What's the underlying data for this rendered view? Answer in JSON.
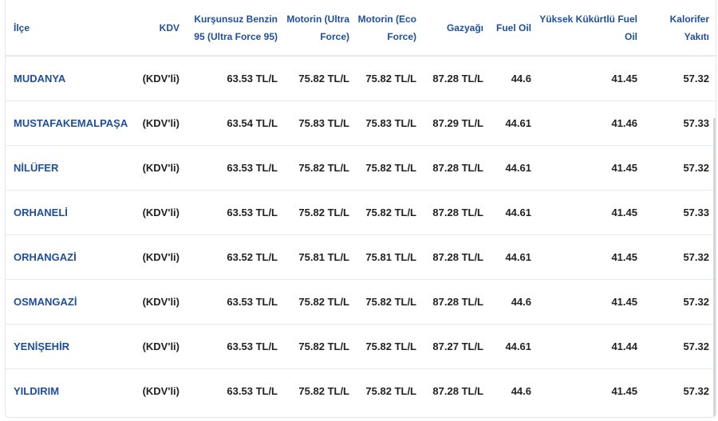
{
  "table": {
    "headers": [
      "İlçe",
      "KDV",
      "Kurşunsuz Benzin 95 (Ultra Force 95)",
      "Motorin (Ultra Force)",
      "Motorin (Eco Force)",
      "Gazyağı",
      "Fuel Oil",
      "Yüksek Kükürtlü Fuel Oil",
      "Kalorifer Yakıtı"
    ],
    "rows": [
      [
        "MUDANYA",
        "(KDV'li)",
        "63.53 TL/L",
        "75.82 TL/L",
        "75.82 TL/L",
        "87.28 TL/L",
        "44.6",
        "41.45",
        "57.32"
      ],
      [
        "MUSTAFAKEMALPAŞA",
        "(KDV'li)",
        "63.54 TL/L",
        "75.83 TL/L",
        "75.83 TL/L",
        "87.29 TL/L",
        "44.61",
        "41.46",
        "57.33"
      ],
      [
        "NİLÜFER",
        "(KDV'li)",
        "63.53 TL/L",
        "75.82 TL/L",
        "75.82 TL/L",
        "87.28 TL/L",
        "44.61",
        "41.45",
        "57.32"
      ],
      [
        "ORHANELİ",
        "(KDV'li)",
        "63.53 TL/L",
        "75.82 TL/L",
        "75.82 TL/L",
        "87.28 TL/L",
        "44.61",
        "41.45",
        "57.33"
      ],
      [
        "ORHANGAZİ",
        "(KDV'li)",
        "63.52 TL/L",
        "75.81 TL/L",
        "75.81 TL/L",
        "87.28 TL/L",
        "44.61",
        "41.45",
        "57.32"
      ],
      [
        "OSMANGAZİ",
        "(KDV'li)",
        "63.53 TL/L",
        "75.82 TL/L",
        "75.82 TL/L",
        "87.28 TL/L",
        "44.6",
        "41.45",
        "57.32"
      ],
      [
        "YENİŞEHİR",
        "(KDV'li)",
        "63.53 TL/L",
        "75.82 TL/L",
        "75.82 TL/L",
        "87.27 TL/L",
        "44.61",
        "41.44",
        "57.32"
      ],
      [
        "YILDIRIM",
        "(KDV'li)",
        "63.53 TL/L",
        "75.82 TL/L",
        "75.82 TL/L",
        "87.28 TL/L",
        "44.6",
        "41.45",
        "57.32"
      ]
    ]
  },
  "colors": {
    "header_text": "#1e4f9c",
    "district_text": "#1e4f9c",
    "cell_text": "#222222",
    "row_border": "#e8eaee"
  }
}
